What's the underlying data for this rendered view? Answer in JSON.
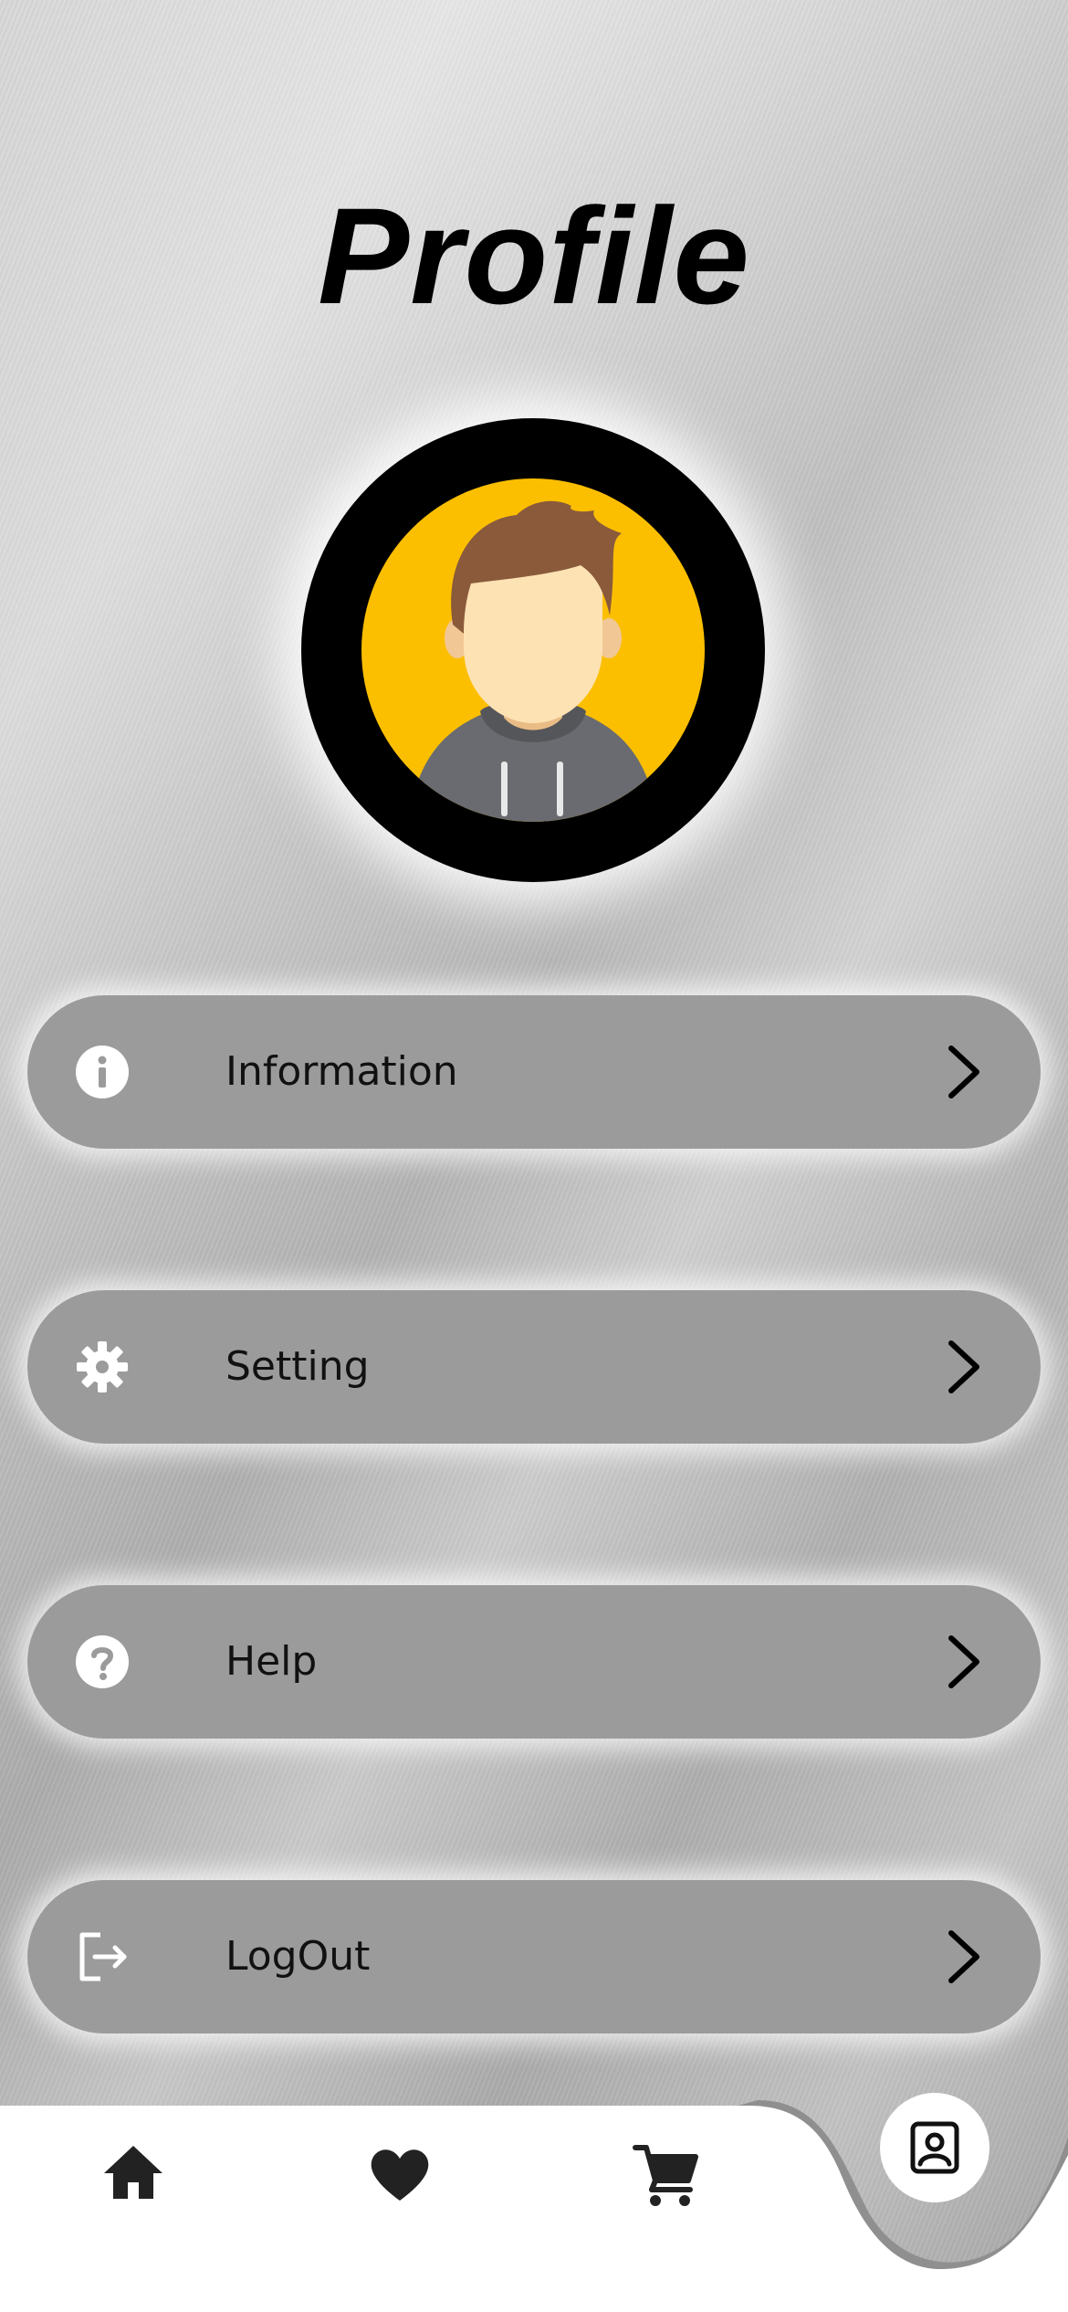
{
  "page": {
    "title": "Profile"
  },
  "avatar": {
    "background_color": "#fcbf00",
    "ring_color": "#000000"
  },
  "menu": {
    "items": [
      {
        "label": "Information",
        "icon": "info-icon"
      },
      {
        "label": "Setting",
        "icon": "gear-icon"
      },
      {
        "label": "Help",
        "icon": "help-icon"
      },
      {
        "label": "LogOut",
        "icon": "logout-icon"
      }
    ]
  },
  "bottom_nav": {
    "items": [
      {
        "icon": "home-icon"
      },
      {
        "icon": "heart-icon"
      },
      {
        "icon": "cart-icon"
      },
      {
        "icon": "profile-icon",
        "active": true
      }
    ]
  },
  "colors": {
    "menu_item_bg": "#9b9b9b",
    "nav_bg": "#ffffff",
    "nav_bump": "#8f8f8f"
  }
}
